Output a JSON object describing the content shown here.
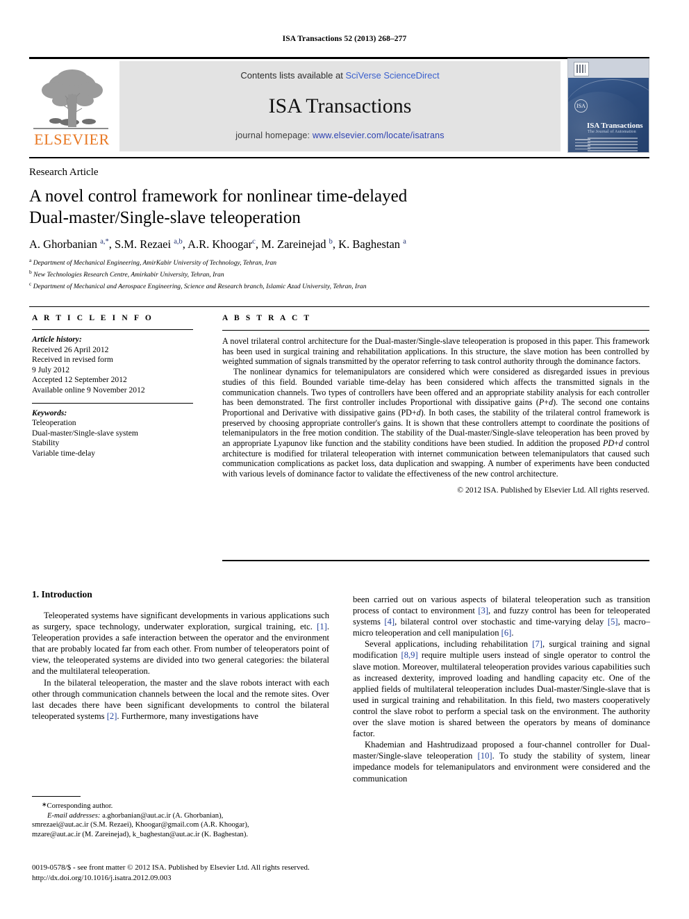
{
  "running_head": "ISA Transactions 52 (2013) 268–277",
  "masthead": {
    "contents_prefix": "Contents lists available at ",
    "contents_link": "SciVerse ScienceDirect",
    "journal_title": "ISA Transactions",
    "homepage_prefix": "journal homepage: ",
    "homepage_url": "www.elsevier.com/locate/isatrans",
    "publisher_logo_text": "ELSEVIER",
    "cover": {
      "title": "ISA Transactions",
      "subtitle": "The Journal of Automation"
    }
  },
  "article": {
    "type": "Research Article",
    "title_line1": "A novel control framework for nonlinear time-delayed",
    "title_line2": "Dual-master/Single-slave teleoperation",
    "authors_html": "A. Ghorbanian <sup>a,*</sup>, S.M. Rezaei <sup>a,b</sup>, A.R. Khoogar<sup>c</sup>, M. Zareinejad <sup>b</sup>, K. Baghestan <sup>a</sup>",
    "affiliations": [
      {
        "marker": "a",
        "text": "Department of Mechanical Engineering, AmirKabir University of Technology, Tehran, Iran"
      },
      {
        "marker": "b",
        "text": "New Technologies Research Centre, Amirkabir University, Tehran, Iran"
      },
      {
        "marker": "c",
        "text": "Department of Mechanical and Aerospace Engineering, Science and Research branch, Islamic Azad University, Tehran, Iran"
      }
    ]
  },
  "article_info": {
    "heading": "A R T I C L E   I N F O",
    "history_label": "Article history:",
    "history": [
      "Received 26 April 2012",
      "Received in revised form",
      "9 July 2012",
      "Accepted 12 September 2012",
      "Available online 9 November 2012"
    ],
    "keywords_label": "Keywords:",
    "keywords": [
      "Teleoperation",
      "Dual-master/Single-slave system",
      "Stability",
      "Variable time-delay"
    ]
  },
  "abstract": {
    "heading": "A B S T R A C T",
    "paragraph1": "A novel trilateral control architecture for the Dual-master/Single-slave teleoperation is proposed in this paper. This framework has been used in surgical training and rehabilitation applications. In this structure, the slave motion has been controlled by weighted summation of signals transmitted by the operator referring to task control authority through the dominance factors.",
    "paragraph2": "The nonlinear dynamics for telemanipulators are considered which were considered as disregarded issues in previous studies of this field. Bounded variable time-delay has been considered which affects the transmitted signals in the communication channels. Two types of controllers have been offered and an appropriate stability analysis for each controller has been demonstrated. The first controller includes Proportional with dissipative gains (P+d). The second one contains Proportional and Derivative with dissipative gains (PD+d). In both cases, the stability of the trilateral control framework is preserved by choosing appropriate controller's gains. It is shown that these controllers attempt to coordinate the positions of telemanipulators in the free motion condition. The stability of the Dual-master/Single-slave teleoperation has been proved by an appropriate Lyapunov like function and the stability conditions have been studied. In addition the proposed PD+d control architecture is modified for trilateral teleoperation with internet communication between telemanipulators that caused such communication complications as packet loss, data duplication and swapping. A number of experiments have been conducted with various levels of dominance factor to validate the effectiveness of the new control architecture.",
    "copyright": "© 2012 ISA. Published by Elsevier Ltd. All rights reserved."
  },
  "introduction": {
    "heading": "1.  Introduction",
    "left_p1": "Teleoperated systems have significant developments in various applications such as surgery, space technology, underwater exploration, surgical training, etc. [1]. Teleoperation provides a safe interaction between the operator and the environment that are probably located far from each other. From number of teleoperators point of view, the teleoperated systems are divided into two general categories: the bilateral and the multilateral teleoperation.",
    "left_p2": "In the bilateral teleoperation, the master and the slave robots interact with each other through communication channels between the local and the remote sites. Over last decades there have been significant developments to control the bilateral teleoperated systems [2]. Furthermore, many investigations have",
    "right_p1": "been carried out on various aspects of bilateral teleoperation such as transition process of contact to environment [3], and fuzzy control has been for teleoperated systems [4], bilateral control over stochastic and time-varying delay [5], macro–micro teleoperation and cell manipulation [6].",
    "right_p2": "Several applications, including rehabilitation [7], surgical training and signal modification [8,9] require multiple users instead of single operator to control the slave motion. Moreover, multilateral teleoperation provides various capabilities such as increased dexterity, improved loading and handling capacity etc. One of the applied fields of multilateral teleoperation includes Dual-master/Single-slave that is used in surgical training and rehabilitation. In this field, two masters cooperatively control the slave robot to perform a special task on the environment. The authority over the slave motion is shared between the operators by means of dominance factor.",
    "right_p3": "Khademian and Hashtrudizaad proposed a four-channel controller for Dual-master/Single-slave teleoperation [10]. To study the stability of system, linear impedance models for telemanipulators and environment were considered and the communication"
  },
  "footnote": {
    "corresponding": "Corresponding author.",
    "email_label": "E-mail addresses:",
    "emails_line1": "a.ghorbanian@aut.ac.ir (A. Ghorbanian),",
    "emails_line2": "smrezaei@aut.ac.ir (S.M. Rezaei), Khoogar@gmail.com (A.R. Khoogar),",
    "emails_line3": "mzare@aut.ac.ir (M. Zareinejad), k_baghestan@aut.ac.ir (K. Baghestan)."
  },
  "imprint": {
    "line1": "0019-0578/$ - see front matter © 2012 ISA. Published by Elsevier Ltd. All rights reserved.",
    "line2": "http://dx.doi.org/10.1016/j.isatra.2012.09.003"
  },
  "colors": {
    "link_blue": "#2a3fb0",
    "reference_blue": "#21409a",
    "elsevier_orange": "#E87722",
    "band_grey": "#e3e3e3"
  }
}
